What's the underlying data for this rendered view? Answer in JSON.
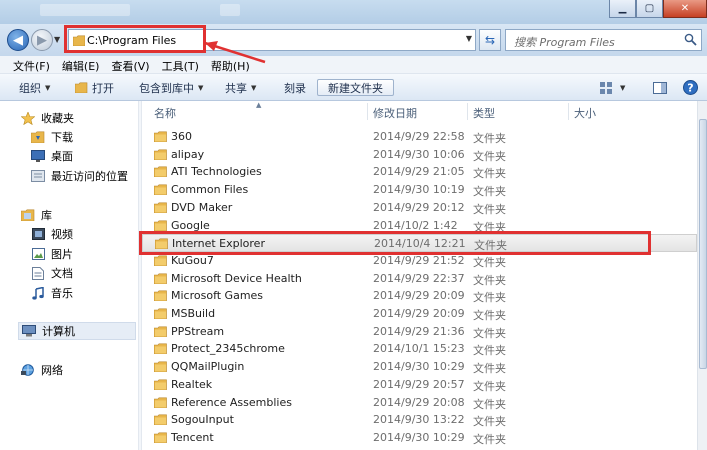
{
  "address_bar": {
    "path": "C:\\Program Files",
    "search_placeholder": "搜索 Program Files"
  },
  "menu": [
    "文件(F)",
    "编辑(E)",
    "查看(V)",
    "工具(T)",
    "帮助(H)"
  ],
  "toolbar": {
    "organize": "组织",
    "open": "打开",
    "include_in_library": "包含到库中",
    "share": "共享",
    "burn": "刻录",
    "new_folder": "新建文件夹"
  },
  "sidebar": {
    "favorites": "收藏夹",
    "downloads": "下载",
    "desktop": "桌面",
    "recent": "最近访问的位置",
    "libraries": "库",
    "videos": "视频",
    "pictures": "图片",
    "documents": "文档",
    "music": "音乐",
    "computer": "计算机",
    "network": "网络"
  },
  "columns": {
    "name": "名称",
    "date_modified": "修改日期",
    "type": "类型",
    "size": "大小"
  },
  "files": [
    {
      "name": "360",
      "date": "2014/9/29 22:58",
      "type": "文件夹"
    },
    {
      "name": "alipay",
      "date": "2014/9/30 10:06",
      "type": "文件夹"
    },
    {
      "name": "ATI Technologies",
      "date": "2014/9/29 21:05",
      "type": "文件夹"
    },
    {
      "name": "Common Files",
      "date": "2014/9/30 10:19",
      "type": "文件夹"
    },
    {
      "name": "DVD Maker",
      "date": "2014/9/29 20:12",
      "type": "文件夹"
    },
    {
      "name": "Google",
      "date": "2014/10/2 1:42",
      "type": "文件夹"
    },
    {
      "name": "Internet Explorer",
      "date": "2014/10/4 12:21",
      "type": "文件夹"
    },
    {
      "name": "KuGou7",
      "date": "2014/9/29 21:52",
      "type": "文件夹"
    },
    {
      "name": "Microsoft Device Health",
      "date": "2014/9/29 22:37",
      "type": "文件夹"
    },
    {
      "name": "Microsoft Games",
      "date": "2014/9/29 20:09",
      "type": "文件夹"
    },
    {
      "name": "MSBuild",
      "date": "2014/9/29 20:09",
      "type": "文件夹"
    },
    {
      "name": "PPStream",
      "date": "2014/9/29 21:36",
      "type": "文件夹"
    },
    {
      "name": "Protect_2345chrome",
      "date": "2014/10/1 15:23",
      "type": "文件夹"
    },
    {
      "name": "QQMailPlugin",
      "date": "2014/9/30 10:29",
      "type": "文件夹"
    },
    {
      "name": "Realtek",
      "date": "2014/9/29 20:57",
      "type": "文件夹"
    },
    {
      "name": "Reference Assemblies",
      "date": "2014/9/29 20:08",
      "type": "文件夹"
    },
    {
      "name": "SogouInput",
      "date": "2014/9/30 13:22",
      "type": "文件夹"
    },
    {
      "name": "Tencent",
      "date": "2014/9/30 10:29",
      "type": "文件夹"
    }
  ],
  "selected_file": "Internet Explorer",
  "colors": {
    "annotation": "#e03131",
    "folder": "#e8b64b",
    "accent": "#2a66b6"
  }
}
